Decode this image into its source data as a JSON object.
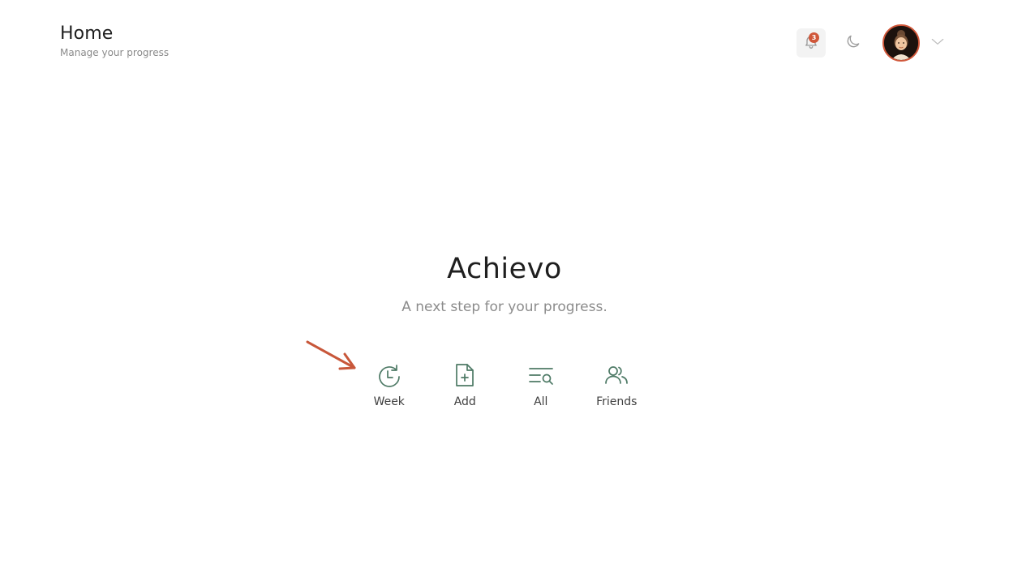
{
  "header": {
    "title": "Home",
    "subtitle": "Manage your progress",
    "notifications_count": "3"
  },
  "hero": {
    "brand": "Achievo",
    "tagline": "A next step for your progress."
  },
  "actions": [
    {
      "label": "Week",
      "icon": "history-icon"
    },
    {
      "label": "Add",
      "icon": "add-file-icon"
    },
    {
      "label": "All",
      "icon": "list-search-icon"
    },
    {
      "label": "Friends",
      "icon": "users-icon"
    }
  ],
  "colors": {
    "accent": "#d0573a",
    "icon_green": "#4e7a66",
    "text_dark": "#1f1f1f",
    "text_muted": "#8c8c8c"
  }
}
